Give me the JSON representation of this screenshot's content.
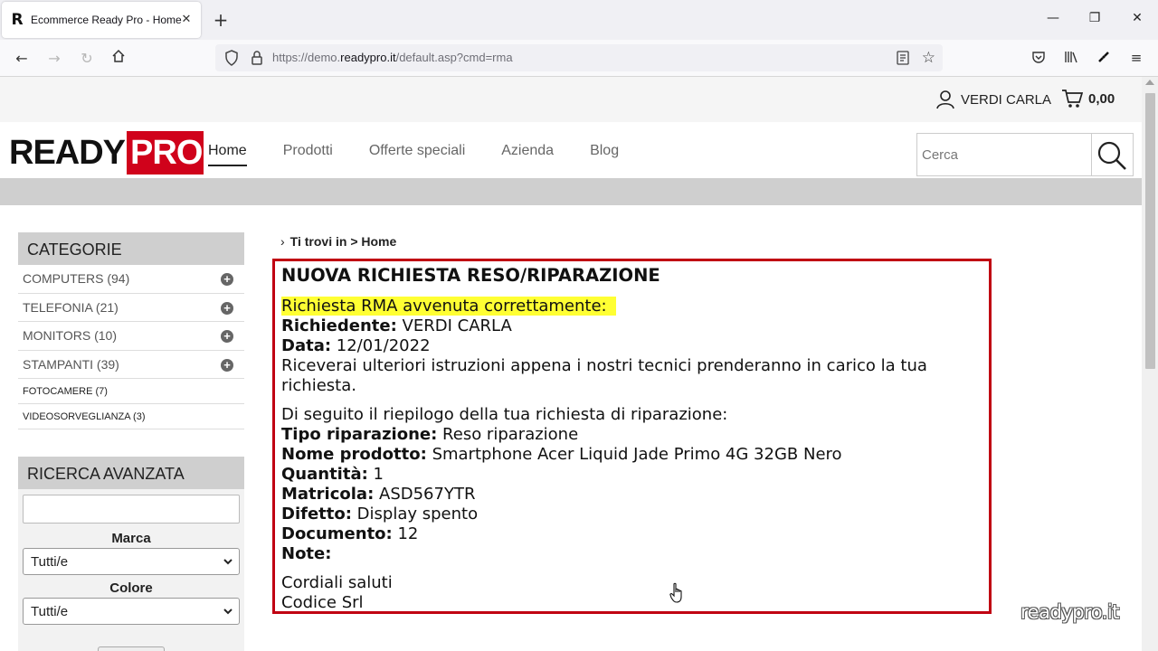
{
  "browser": {
    "tab_title": "Ecommerce Ready Pro - Home",
    "url_prefix": "https://demo.",
    "url_domain": "readypro.it",
    "url_path": "/default.asp?cmd=rma"
  },
  "header": {
    "account_name": "VERDI CARLA",
    "cart_total": "0,00",
    "logo_left": "READY",
    "logo_right": "PRO",
    "nav": [
      "Home",
      "Prodotti",
      "Offerte speciali",
      "Azienda",
      "Blog"
    ],
    "search_placeholder": "Cerca"
  },
  "sidebar": {
    "categories_title": "CATEGORIE",
    "categories": [
      {
        "label": "COMPUTERS (94)"
      },
      {
        "label": "TELEFONIA (21)"
      },
      {
        "label": "MONITORS (10)"
      },
      {
        "label": "STAMPANTI (39)"
      },
      {
        "label": "FOTOCAMERE (7)"
      },
      {
        "label": "VIDEOSORVEGLIANZA (3)"
      }
    ],
    "advanced_title": "RICERCA AVANZATA",
    "brand_label": "Marca",
    "brand_value": "Tutti/e",
    "color_label": "Colore",
    "color_value": "Tutti/e"
  },
  "breadcrumb": {
    "prefix": "Ti trovi in",
    "separator": ">",
    "current": "Home"
  },
  "rma": {
    "title": "NUOVA RICHIESTA RESO/RIPARAZIONE",
    "success": "Richiesta RMA avvenuta correttamente:",
    "requester_label": "Richiedente:",
    "requester_value": "VERDI CARLA",
    "date_label": "Data:",
    "date_value": "12/01/2022",
    "info": "Riceverai ulteriori istruzioni appena i nostri tecnici prenderanno in carico la tua richiesta.",
    "summary_intro": "Di seguito il riepilogo della tua richiesta di riparazione:",
    "type_label": "Tipo riparazione:",
    "type_value": "Reso riparazione",
    "product_label": "Nome prodotto:",
    "product_value": "Smartphone Acer Liquid Jade Primo 4G 32GB Nero",
    "qty_label": "Quantità:",
    "qty_value": "1",
    "serial_label": "Matricola:",
    "serial_value": "ASD567YTR",
    "defect_label": "Difetto:",
    "defect_value": "Display spento",
    "doc_label": "Documento:",
    "doc_value": "12",
    "notes_label": "Note:",
    "greeting": "Cordiali saluti",
    "company": "Codice Srl"
  },
  "watermark": "readypro.it",
  "colors": {
    "brand_red": "#d0021b",
    "card_border": "#c00012",
    "highlight": "#ffff33"
  }
}
